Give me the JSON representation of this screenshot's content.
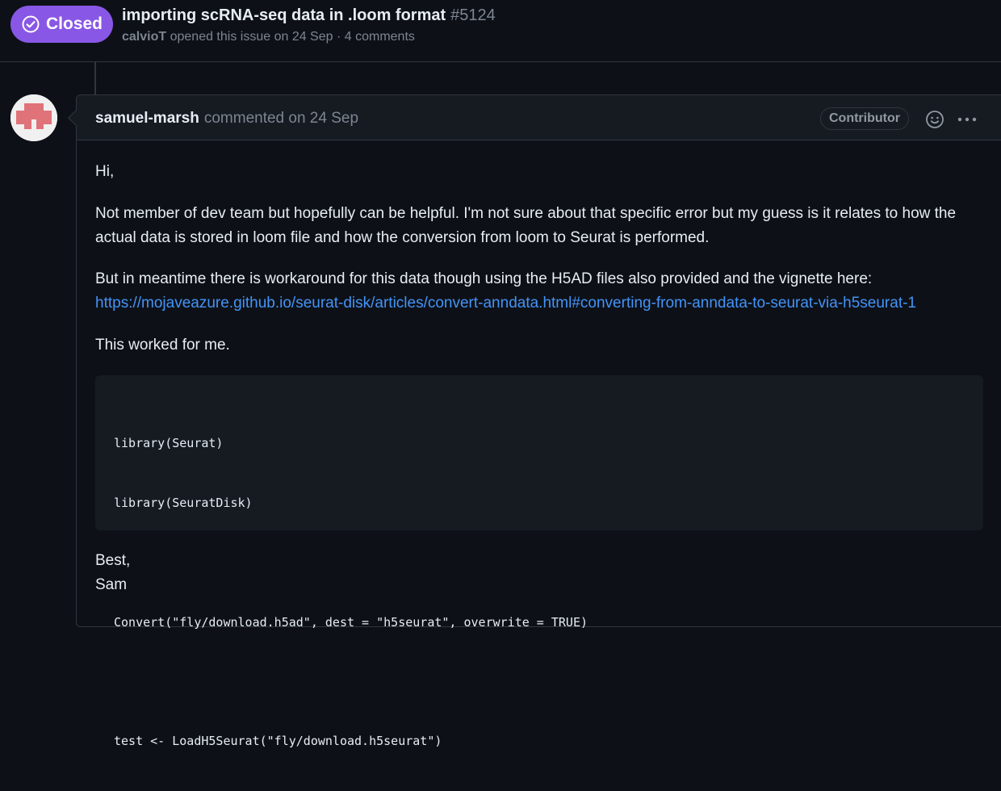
{
  "issue": {
    "state": "Closed",
    "title": "importing scRNA-seq data in .loom format",
    "number": "#5124",
    "author": "calvioT",
    "meta_text": "opened this issue on 24 Sep · 4 comments",
    "state_color": "#8957e5"
  },
  "comment": {
    "author": "samuel-marsh",
    "action": "commented on 24 Sep",
    "role_badge": "Contributor",
    "reaction_icon": "smiley-icon",
    "more_icon": "kebab-horizontal-icon",
    "greeting": "Hi,",
    "paragraph_1": "Not member of dev team but hopefully can be helpful. I'm not sure about that specific error but my guess is it relates to how the actual data is stored in loom file and how the conversion from loom to Seurat is performed.",
    "paragraph_2_text": "But in meantime there is workaround for this data though using the H5AD files also provided and the vignette here:",
    "paragraph_2_link": "https://mojaveazure.github.io/seurat-disk/articles/convert-anndata.html#converting-from-anndata-to-seurat-via-h5seurat-1",
    "paragraph_3": "This worked for me.",
    "code_lines": [
      "library(Seurat)",
      "library(SeuratDisk)",
      "",
      "Convert(\"fly/download.h5ad\", dest = \"h5seurat\", overwrite = TRUE)",
      "",
      "test <- LoadH5Seurat(\"fly/download.h5seurat\")"
    ],
    "sign_off_1": "Best,",
    "sign_off_2": "Sam",
    "link_color": "#4493f8"
  }
}
